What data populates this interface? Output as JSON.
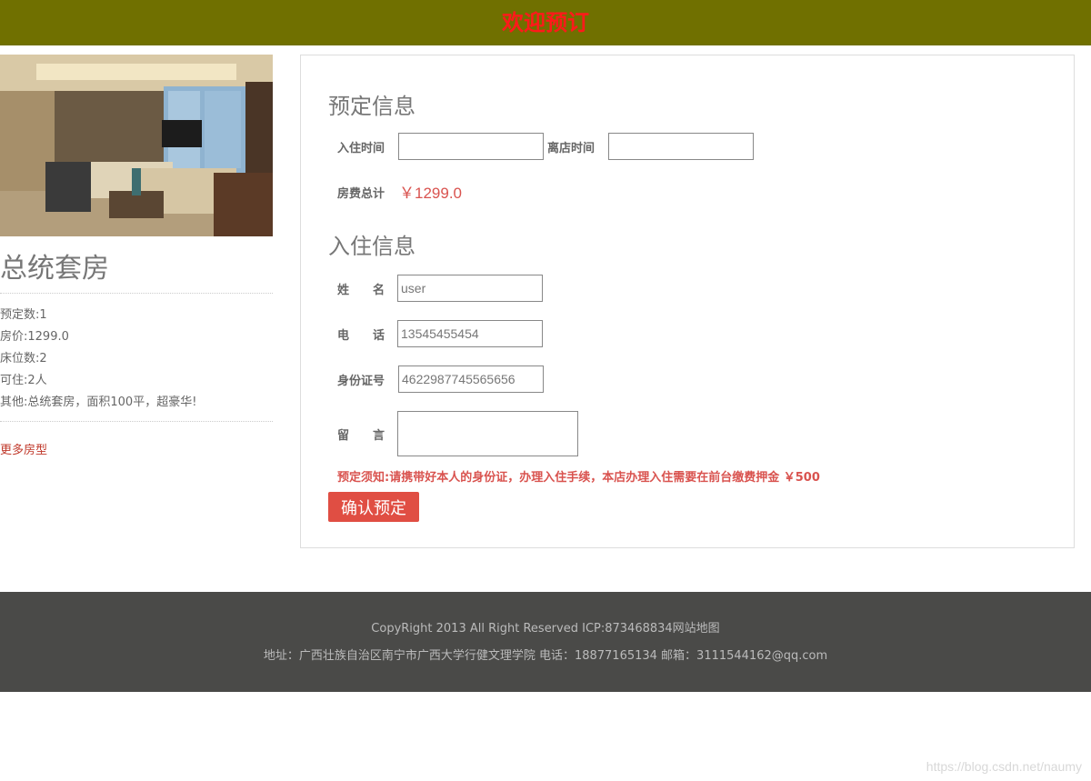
{
  "header": {
    "title": "欢迎预订"
  },
  "room": {
    "photo_alt": "room-photo",
    "name": "总统套房",
    "info": [
      "预定数:1",
      "房价:1299.0",
      "床位数:2",
      "可住:2人",
      "其他:总统套房，面积100平，超豪华!"
    ],
    "more_link": "更多房型"
  },
  "booking": {
    "section_title": "预定信息",
    "checkin_label": "入住时间",
    "checkin_value": "",
    "checkout_label": "离店时间",
    "checkout_value": "",
    "total_label": "房费总计",
    "total_value": "￥1299.0"
  },
  "guest": {
    "section_title": "入住信息",
    "name_label": "姓　　名",
    "name_value": "user",
    "phone_label": "电　　话",
    "phone_value": "13545455454",
    "id_label": "身份证号",
    "id_value": "4622987745565656",
    "message_label": "留　　言",
    "message_value": ""
  },
  "notice": "预定须知:请携带好本人的身份证，办理入住手续，本店办理入住需要在前台缴费押金 ￥500",
  "confirm_label": "确认预定",
  "footer": {
    "line1": "CopyRight 2013 All Right Reserved  ICP:873468834网站地图",
    "line2": "地址：广西壮族自治区南宁市广西大学行健文理学院  电话：18877165134  邮箱：3111544162@qq.com"
  },
  "watermark": "https://blog.csdn.net/naumy"
}
